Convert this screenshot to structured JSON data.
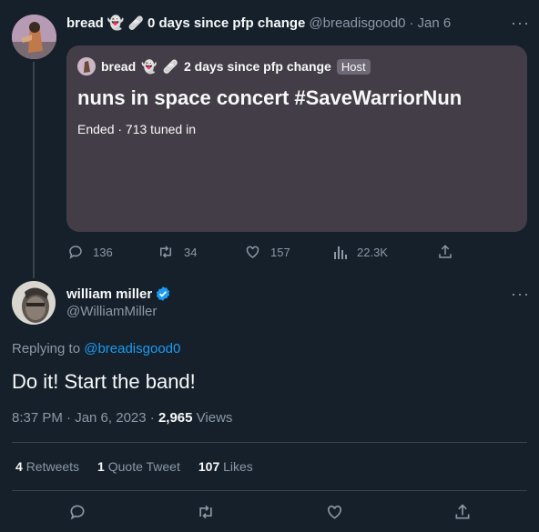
{
  "colors": {
    "background": "#15202b",
    "card": "#433d47",
    "muted": "#8b98a5",
    "link": "#1d9bf0",
    "verified": "#1d9bf0"
  },
  "tweet1": {
    "name": "bread",
    "name_suffix": "0 days since pfp change",
    "handle": "@breadisgood0",
    "date": "Jan 6",
    "more": "···",
    "space": {
      "host_name": "bread",
      "host_suffix": "2 days since pfp change",
      "host_badge": "Host",
      "title": "nuns in space concert #SaveWarriorNun",
      "status": "Ended · 713 tuned in"
    },
    "actions": {
      "replies": "136",
      "retweets": "34",
      "likes": "157",
      "views": "22.3K"
    }
  },
  "tweet2": {
    "name": "william miller",
    "handle": "@WilliamMiller",
    "more": "···",
    "replying_prefix": "Replying to",
    "replying_to": "@breadisgood0",
    "text": "Do it! Start the band!",
    "time": "8:37 PM · Jan 6, 2023 ·",
    "views_count": "2,965",
    "views_label": "Views",
    "stats": {
      "retweets_count": "4",
      "retweets_label": "Retweets",
      "quotes_count": "1",
      "quotes_label": "Quote Tweet",
      "likes_count": "107",
      "likes_label": "Likes"
    }
  }
}
